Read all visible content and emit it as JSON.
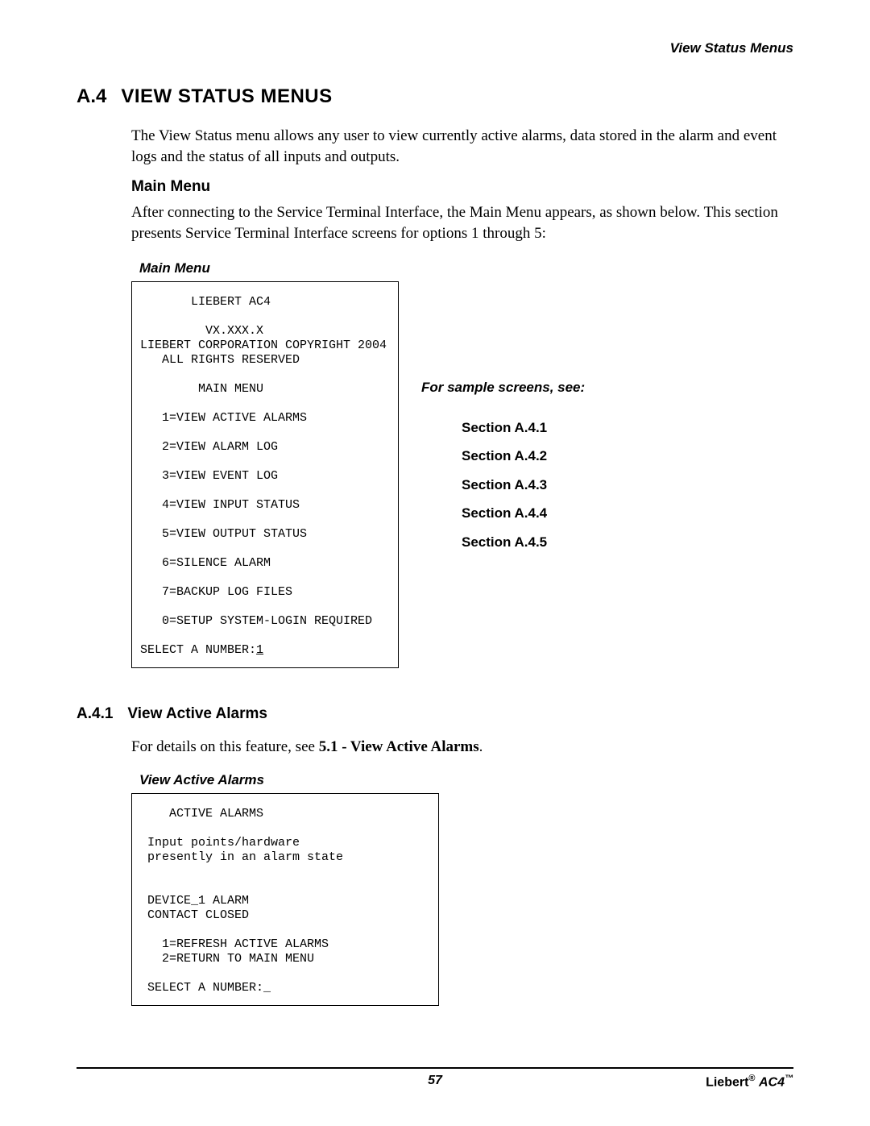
{
  "running_head": "View Status Menus",
  "section": {
    "number": "A.4",
    "title": "VIEW STATUS MENUS",
    "intro": "The View Status menu allows any user to view currently active alarms, data stored in the alarm and event logs and the status of all inputs and outputs."
  },
  "mainmenu": {
    "heading": "Main Menu",
    "text": "After connecting to the Service Terminal Interface, the Main Menu appears, as shown below. This section presents Service Terminal Interface screens for options 1 through 5:",
    "caption": "Main Menu",
    "screen_top": "       LIEBERT AC4\n\n         VX.XXX.X\nLIEBERT CORPORATION COPYRIGHT 2004\n   ALL RIGHTS RESERVED\n\n        MAIN MENU\n\n",
    "options": [
      "   1=VIEW ACTIVE ALARMS",
      "   2=VIEW ALARM LOG",
      "   3=VIEW EVENT LOG",
      "   4=VIEW INPUT STATUS",
      "   5=VIEW OUTPUT STATUS",
      "   6=SILENCE ALARM",
      "   7=BACKUP LOG FILES",
      "   0=SETUP SYSTEM-LOGIN REQUIRED"
    ],
    "prompt": "SELECT A NUMBER:",
    "prompt_value": "1",
    "refs_lead": "For sample screens, see:",
    "refs": [
      "Section A.4.1",
      "Section A.4.2",
      "Section A.4.3",
      "Section A.4.4",
      "Section A.4.5"
    ]
  },
  "subsection": {
    "number": "A.4.1",
    "title": "View Active Alarms",
    "cross_pre": "For details on this feature, see ",
    "cross_bold": "5.1 - View Active Alarms",
    "cross_post": ".",
    "caption": "View Active Alarms",
    "screen": "    ACTIVE ALARMS\n\n Input points/hardware\n presently in an alarm state\n\n\n DEVICE_1 ALARM\n CONTACT CLOSED\n\n   1=REFRESH ACTIVE ALARMS\n   2=RETURN TO MAIN MENU\n\n SELECT A NUMBER:_"
  },
  "footer": {
    "page": "57",
    "brand": "Liebert",
    "product": "AC4"
  }
}
